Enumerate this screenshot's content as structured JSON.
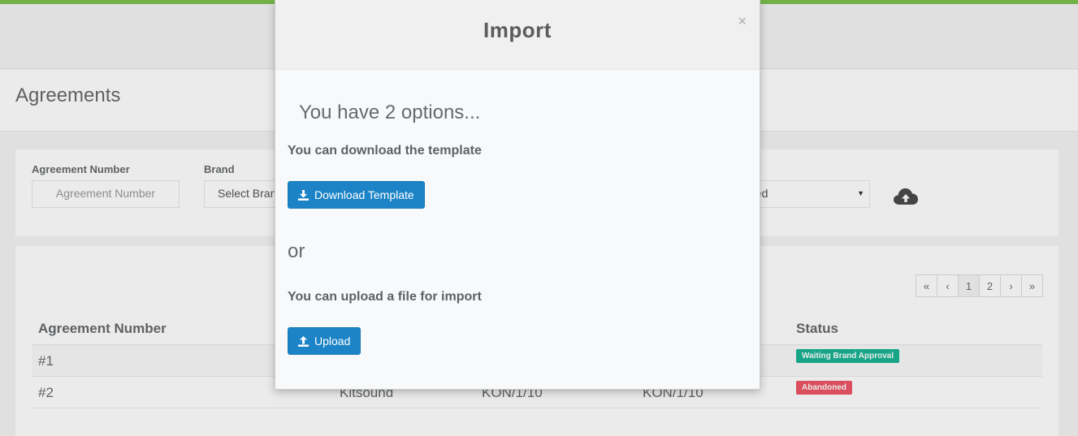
{
  "page": {
    "title": "Agreements"
  },
  "filters": {
    "agreement_number_label": "Agreement Number",
    "agreement_number_placeholder": "Agreement Number",
    "brand_label": "Brand",
    "brand_value": "Select Brand",
    "status_value": "Enabled"
  },
  "pagination": [
    "«",
    "‹",
    "1",
    "2",
    "›",
    "»"
  ],
  "table": {
    "headers": {
      "agreement_number": "Agreement Number",
      "status": "Status"
    },
    "rows": [
      {
        "number": "#1",
        "brand": "",
        "col3": "",
        "col4": "",
        "status": "Waiting Brand Approval",
        "status_color": "#1ab394"
      },
      {
        "number": "#2",
        "brand": "Kitsound",
        "col3": "KON/1/10",
        "col4": "KON/1/10",
        "status": "Abandoned",
        "status_color": "#ed5565"
      }
    ]
  },
  "modal": {
    "title": "Import",
    "close": "×",
    "heading": "You have 2 options...",
    "download_text": "You can download the template",
    "download_button": "Download Template",
    "or_text": "or",
    "upload_text": "You can upload a file for import",
    "upload_button": "Upload"
  },
  "colors": {
    "accent": "#7cc24f",
    "primary_button": "#1c84c6"
  }
}
